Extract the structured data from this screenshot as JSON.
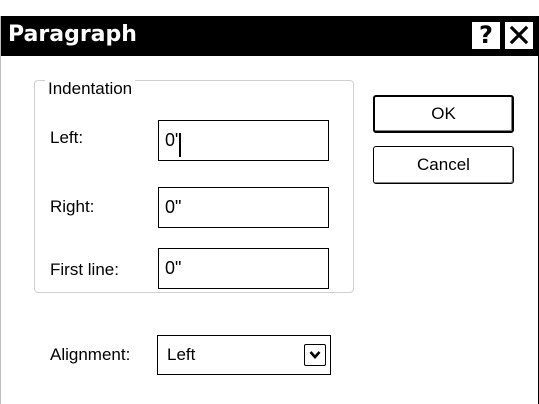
{
  "dialog": {
    "title": "Paragraph",
    "help_glyph": "?",
    "help_icon": "question-mark-icon",
    "close_icon": "close-x-icon"
  },
  "indentation": {
    "legend": "Indentation",
    "left_label": "Left:",
    "left_value": "0\"",
    "right_label": "Right:",
    "right_value": "0\"",
    "first_line_label": "First line:",
    "first_line_value": "0\""
  },
  "alignment": {
    "label": "Alignment:",
    "selected": "Left",
    "dropdown_icon": "chevron-down-icon"
  },
  "buttons": {
    "ok": "OK",
    "cancel": "Cancel"
  },
  "colors": {
    "titlebar_bg": "#000000",
    "titlebar_text": "#ffffff",
    "window_bg": "#ffffff"
  }
}
